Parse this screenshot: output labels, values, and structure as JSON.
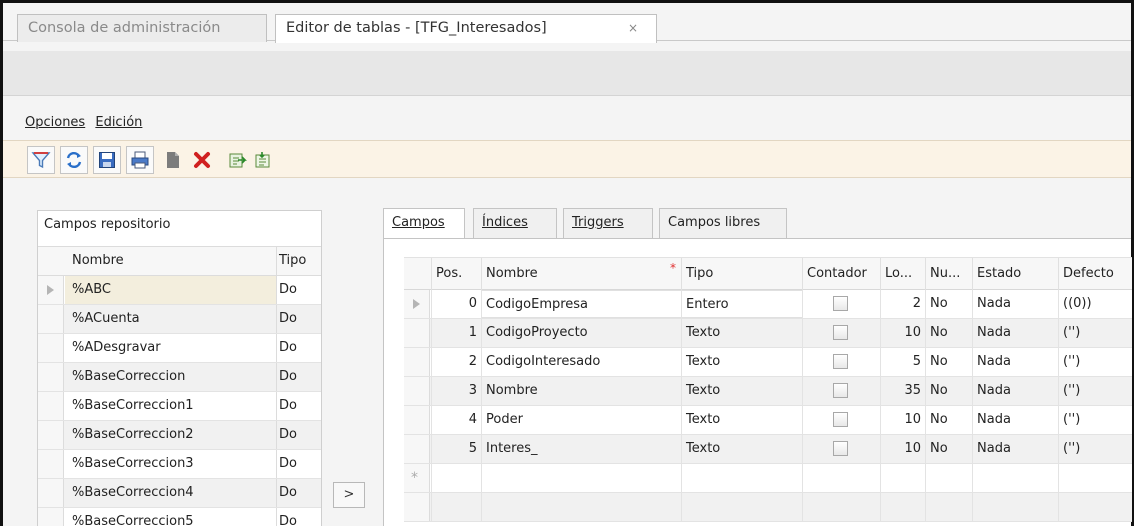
{
  "tabs": [
    {
      "label": "Consola de administración",
      "active": false
    },
    {
      "label": "Editor de tablas - [TFG_Interesados]",
      "active": true,
      "close": "×"
    }
  ],
  "menu": [
    {
      "label": "Opciones",
      "mnemonic": "O"
    },
    {
      "label": "Edición",
      "mnemonic": "E"
    }
  ],
  "toolbar": {
    "icons": [
      "filter-icon",
      "refresh-icon",
      "save-icon",
      "print-icon",
      "new-document-icon",
      "delete-icon",
      "export-icon",
      "import-icon"
    ]
  },
  "repository": {
    "title": "Campos repositorio",
    "columns": [
      "Nombre",
      "Tipo"
    ],
    "rows": [
      {
        "nombre": "%ABC",
        "tipo": "Do"
      },
      {
        "nombre": "%ACuenta",
        "tipo": "Do"
      },
      {
        "nombre": "%ADesgravar",
        "tipo": "Do"
      },
      {
        "nombre": "%BaseCorreccion",
        "tipo": "Do"
      },
      {
        "nombre": "%BaseCorreccion1",
        "tipo": "Do"
      },
      {
        "nombre": "%BaseCorreccion2",
        "tipo": "Do"
      },
      {
        "nombre": "%BaseCorreccion3",
        "tipo": "Do"
      },
      {
        "nombre": "%BaseCorreccion4",
        "tipo": "Do"
      },
      {
        "nombre": "%BaseCorreccion5",
        "tipo": "Do"
      }
    ],
    "move_button": ">"
  },
  "editor_tabs": [
    {
      "label": "Campos",
      "active": true
    },
    {
      "label": "Índices",
      "active": false
    },
    {
      "label": "Triggers",
      "active": false
    },
    {
      "label": "Campos libres",
      "active": false
    }
  ],
  "fields_grid": {
    "columns": [
      "Pos.",
      "Nombre",
      "Tipo",
      "Contador",
      "Lo...",
      "Nu...",
      "Estado",
      "Defecto"
    ],
    "required_marker": "*",
    "new_row_marker": "*",
    "rows": [
      {
        "pos": "0",
        "nombre": "CodigoEmpresa",
        "tipo": "Entero",
        "contador": false,
        "longitud": "2",
        "nulo": "No",
        "estado": "Nada",
        "defecto": "((0))"
      },
      {
        "pos": "1",
        "nombre": "CodigoProyecto",
        "tipo": "Texto",
        "contador": false,
        "longitud": "10",
        "nulo": "No",
        "estado": "Nada",
        "defecto": "('')"
      },
      {
        "pos": "2",
        "nombre": "CodigoInteresado",
        "tipo": "Texto",
        "contador": false,
        "longitud": "5",
        "nulo": "No",
        "estado": "Nada",
        "defecto": "('')"
      },
      {
        "pos": "3",
        "nombre": "Nombre",
        "tipo": "Texto",
        "contador": false,
        "longitud": "35",
        "nulo": "No",
        "estado": "Nada",
        "defecto": "('')"
      },
      {
        "pos": "4",
        "nombre": "Poder",
        "tipo": "Texto",
        "contador": false,
        "longitud": "10",
        "nulo": "No",
        "estado": "Nada",
        "defecto": "('')"
      },
      {
        "pos": "5",
        "nombre": "Interes_",
        "tipo": "Texto",
        "contador": false,
        "longitud": "10",
        "nulo": "No",
        "estado": "Nada",
        "defecto": "('')"
      }
    ]
  }
}
